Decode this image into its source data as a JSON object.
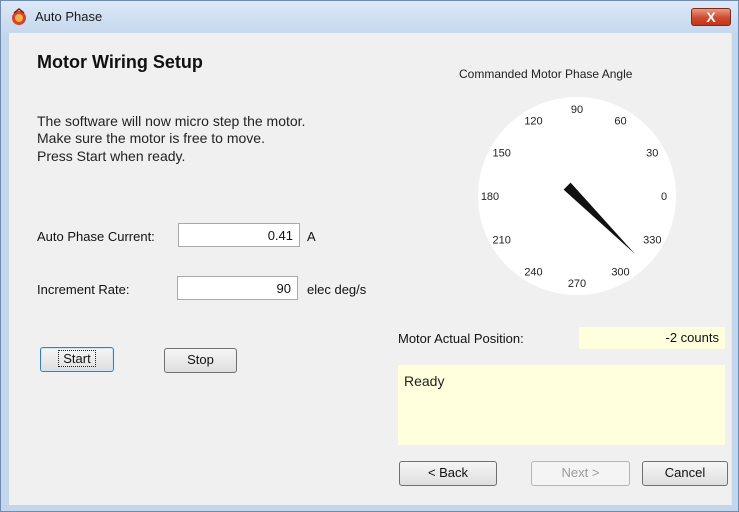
{
  "window": {
    "title": "Auto Phase",
    "close_label": "X"
  },
  "heading": "Motor Wiring Setup",
  "instructions": [
    "The software will now micro step the motor.",
    "Make sure the motor is free to move.",
    "Press Start when ready."
  ],
  "auto_phase_current": {
    "label": "Auto Phase Current:",
    "value": "0.41",
    "unit": "A"
  },
  "increment_rate": {
    "label": "Increment Rate:",
    "value": "90",
    "unit": "elec deg/s"
  },
  "buttons": {
    "start": "Start",
    "stop": "Stop",
    "back": "< Back",
    "next": "Next >",
    "cancel": "Cancel"
  },
  "dial": {
    "title": "Commanded Motor Phase Angle",
    "ticks": [
      "0",
      "30",
      "60",
      "90",
      "120",
      "150",
      "180",
      "210",
      "240",
      "270",
      "300",
      "330"
    ],
    "needle_angle_deg": 315
  },
  "motor_actual_position": {
    "label": "Motor Actual Position:",
    "value": "-2 counts"
  },
  "status": "Ready"
}
